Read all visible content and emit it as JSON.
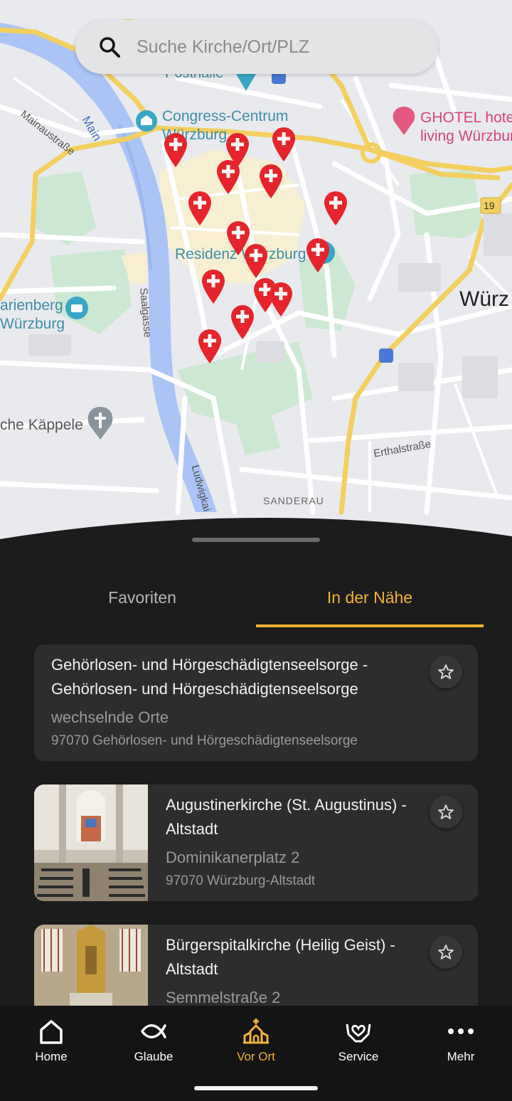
{
  "search": {
    "placeholder": "Suche Kirche/Ort/PLZ"
  },
  "map_labels": {
    "posthalle": "Posthalle",
    "congress_line1": "Congress-Centrum",
    "congress_line2": "Würzburg",
    "ghotel_line1": "GHOTEL hotel",
    "ghotel_line2": "living Würzburg",
    "mainaustrasse": "Mainaustraße",
    "main": "Main",
    "residenz": "Residenz Würzburg",
    "wuerzburg": "Würz",
    "marienberg_line1": "arienberg",
    "marienberg_line2": "Würzburg",
    "saalgasse": "Saalgasse",
    "kaeppele": "che Käppele",
    "erthalstrasse": "Erthalstraße",
    "ludwigkai": "Ludwigkai",
    "sanderau": "SANDERAU",
    "road_badge": "19"
  },
  "colors": {
    "accent": "#f2b233",
    "pin": "#e5252b",
    "background": "#1c1c1c",
    "card": "#2d2d2d"
  },
  "tabs": {
    "favorites": "Favoriten",
    "nearby": "In der Nähe",
    "active": "nearby"
  },
  "churches": [
    {
      "title": "Gehörlosen- und Hörgeschädigtenseelsorge - Gehörlosen- und Hörgeschädigtenseelsorge",
      "street": "wechselnde Orte",
      "city": "97070 Gehörlosen- und Hörgeschädigtenseelsorge",
      "has_image": false
    },
    {
      "title": "Augustinerkirche (St. Augustinus) - Altstadt",
      "street": "Dominikanerplatz 2",
      "city": "97070 Würzburg-Altstadt",
      "has_image": true
    },
    {
      "title": "Bürgerspitalkirche (Heilig Geist) - Altstadt",
      "street": "Semmelstraße 2",
      "city": "",
      "has_image": true
    }
  ],
  "nav": [
    {
      "label": "Home",
      "icon": "home-icon"
    },
    {
      "label": "Glaube",
      "icon": "fish-icon"
    },
    {
      "label": "Vor Ort",
      "icon": "church-icon",
      "active": true
    },
    {
      "label": "Service",
      "icon": "hands-heart-icon"
    },
    {
      "label": "Mehr",
      "icon": "more-dots-icon"
    }
  ]
}
